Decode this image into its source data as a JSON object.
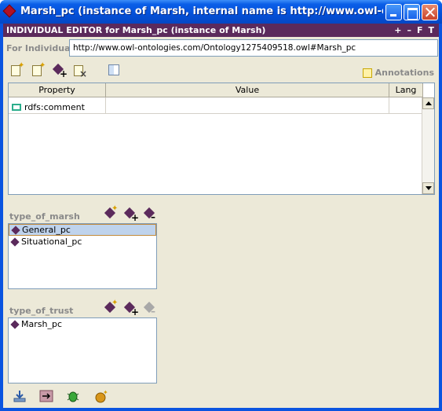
{
  "window": {
    "title": "Marsh_pc    (instance of Marsh, internal name is http://www.owl-ontolog..."
  },
  "editor": {
    "header_title": "INDIVIDUAL EDITOR for Marsh_pc  (instance of Marsh)",
    "header_actions": [
      "+",
      "–",
      "F",
      "T"
    ],
    "for_individual_label": "For Individual:",
    "for_individual_value": "http://www.owl-ontologies.com/Ontology1275409518.owl#Marsh_pc",
    "annotations_label": "Annotations"
  },
  "property_table": {
    "columns": [
      "Property",
      "Value",
      "Lang"
    ],
    "rows": [
      {
        "property": "rdfs:comment",
        "value": "",
        "lang": ""
      }
    ]
  },
  "type_of_marsh": {
    "label": "type_of_marsh",
    "items": [
      "General_pc",
      "Situational_pc"
    ],
    "selected": "General_pc"
  },
  "type_of_trust": {
    "label": "type_of_trust",
    "items": [
      "Marsh_pc"
    ]
  },
  "colors": {
    "header_bg": "#5b2a5c",
    "titlebar_blue": "#0450d8",
    "selection_bg": "#bfd3ec"
  }
}
